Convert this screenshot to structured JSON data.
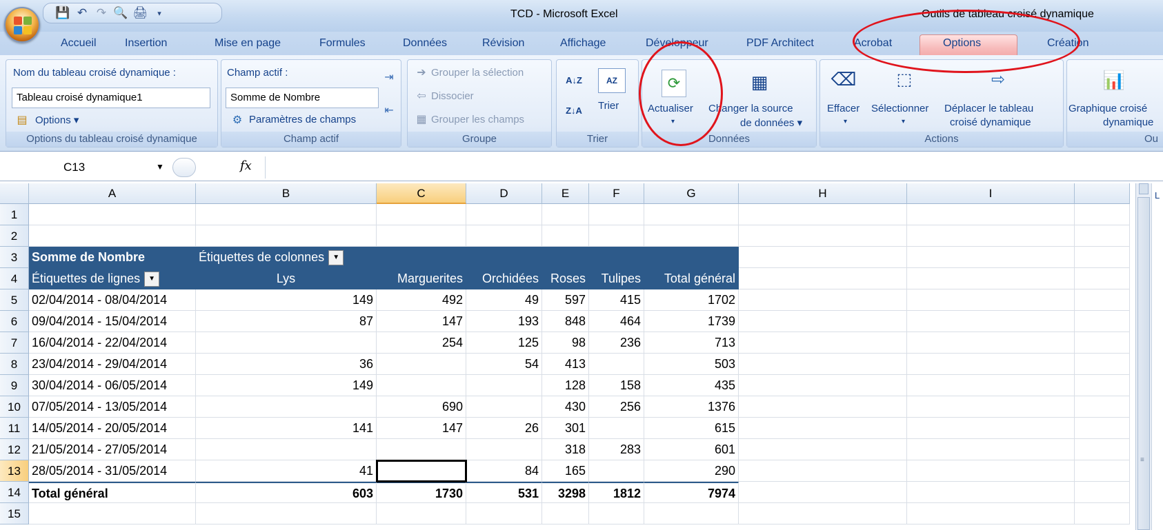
{
  "app": {
    "title": "TCD - Microsoft Excel",
    "contextual_tools": "Outils de tableau croisé dynamique"
  },
  "tabs": [
    "Accueil",
    "Insertion",
    "Mise en page",
    "Formules",
    "Données",
    "Révision",
    "Affichage",
    "Développeur",
    "PDF Architect",
    "Acrobat",
    "Options",
    "Création"
  ],
  "active_tab": "Options",
  "ribbon": {
    "pt_options": {
      "name_label": "Nom du tableau croisé dynamique :",
      "name_value": "Tableau croisé dynamique1",
      "options_label": "Options",
      "group_label": "Options du tableau croisé dynamique"
    },
    "active_field": {
      "label": "Champ actif :",
      "value": "Somme de Nombre",
      "settings_label": "Paramètres de champs",
      "group_label": "Champ actif"
    },
    "group": {
      "group_selection": "Grouper la sélection",
      "ungroup": "Dissocier",
      "group_fields": "Grouper les champs",
      "group_label": "Groupe"
    },
    "sort": {
      "sort_label": "Trier",
      "group_label": "Trier"
    },
    "data": {
      "refresh_label": "Actualiser",
      "change_source_line1": "Changer la source",
      "change_source_line2": "de données",
      "group_label": "Données"
    },
    "actions": {
      "clear_label": "Effacer",
      "select_label": "Sélectionner",
      "move_line1": "Déplacer le tableau",
      "move_line2": "croisé dynamique",
      "group_label": "Actions"
    },
    "tools": {
      "chart_line1": "Graphique croisé",
      "chart_line2": "dynamique",
      "group_label": "Ou"
    }
  },
  "formula_bar": {
    "name_box": "C13",
    "fx": "fx",
    "content": ""
  },
  "columns": [
    "A",
    "B",
    "C",
    "D",
    "E",
    "F",
    "G",
    "H",
    "I"
  ],
  "selected_column": "C",
  "rows": [
    "1",
    "2",
    "3",
    "4",
    "5",
    "6",
    "7",
    "8",
    "9",
    "10",
    "11",
    "12",
    "13",
    "14",
    "15"
  ],
  "selected_row": "13",
  "pivot": {
    "value_label": "Somme de Nombre",
    "column_labels": "Étiquettes de colonnes",
    "row_labels": "Étiquettes de lignes",
    "headers": [
      "Lys",
      "Marguerites",
      "Orchidées",
      "Roses",
      "Tulipes",
      "Total général"
    ],
    "data_rows": [
      {
        "label": "02/04/2014 - 08/04/2014",
        "values": [
          "149",
          "492",
          "49",
          "597",
          "415",
          "1702"
        ]
      },
      {
        "label": "09/04/2014 - 15/04/2014",
        "values": [
          "87",
          "147",
          "193",
          "848",
          "464",
          "1739"
        ]
      },
      {
        "label": "16/04/2014 - 22/04/2014",
        "values": [
          "",
          "254",
          "125",
          "98",
          "236",
          "713"
        ]
      },
      {
        "label": "23/04/2014 - 29/04/2014",
        "values": [
          "36",
          "",
          "54",
          "413",
          "",
          "503"
        ]
      },
      {
        "label": "30/04/2014 - 06/05/2014",
        "values": [
          "149",
          "",
          "",
          "128",
          "158",
          "435"
        ]
      },
      {
        "label": "07/05/2014 - 13/05/2014",
        "values": [
          "",
          "690",
          "",
          "430",
          "256",
          "1376"
        ]
      },
      {
        "label": "14/05/2014 - 20/05/2014",
        "values": [
          "141",
          "147",
          "26",
          "301",
          "",
          "615"
        ]
      },
      {
        "label": "21/05/2014 - 27/05/2014",
        "values": [
          "",
          "",
          "",
          "318",
          "283",
          "601"
        ]
      },
      {
        "label": "28/05/2014 - 31/05/2014",
        "values": [
          "41",
          "",
          "84",
          "165",
          "",
          "290"
        ]
      }
    ],
    "total": {
      "label": "Total général",
      "values": [
        "603",
        "1730",
        "531",
        "3298",
        "1812",
        "7974"
      ]
    }
  },
  "colors": {
    "pivot_header": "#2d5a8a",
    "highlight_circle": "#e0141c",
    "options_tab": "#f7bcbc"
  }
}
